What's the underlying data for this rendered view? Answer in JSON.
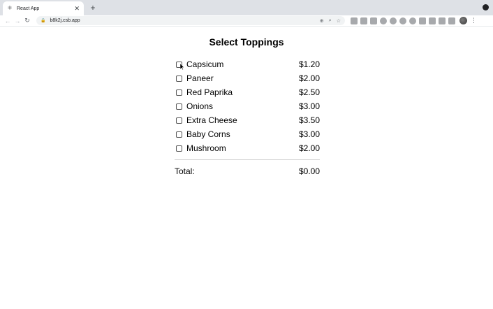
{
  "browser": {
    "tab_title": "React App",
    "tab_close": "✕",
    "new_tab": "+",
    "url": "b8k2j.csb.app",
    "back": "←",
    "forward": "→",
    "reload": "↻",
    "menu": "⋮"
  },
  "page": {
    "title": "Select Toppings",
    "toppings": [
      {
        "name": "Capsicum",
        "price": "$1.20",
        "checked": false
      },
      {
        "name": "Paneer",
        "price": "$2.00",
        "checked": false
      },
      {
        "name": "Red Paprika",
        "price": "$2.50",
        "checked": false
      },
      {
        "name": "Onions",
        "price": "$3.00",
        "checked": false
      },
      {
        "name": "Extra Cheese",
        "price": "$3.50",
        "checked": false
      },
      {
        "name": "Baby Corns",
        "price": "$3.00",
        "checked": false
      },
      {
        "name": "Mushroom",
        "price": "$2.00",
        "checked": false
      }
    ],
    "total_label": "Total:",
    "total_value": "$0.00"
  }
}
